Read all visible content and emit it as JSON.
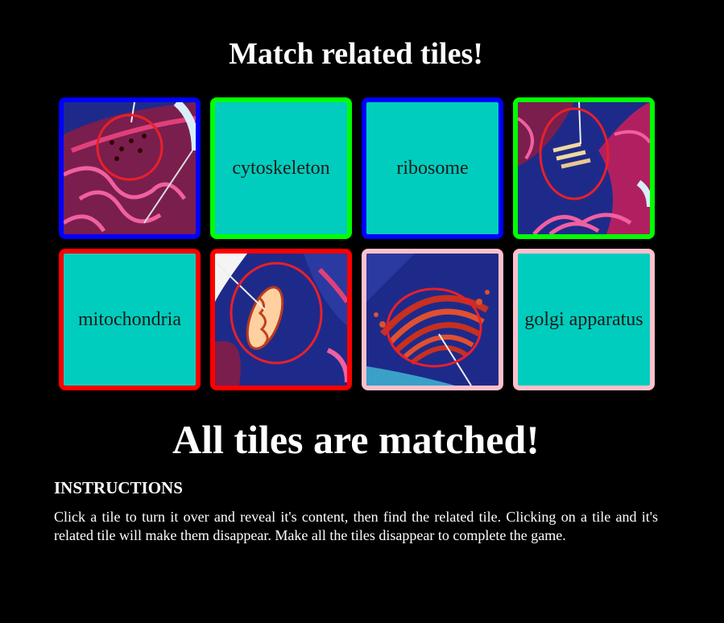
{
  "title": "Match related tiles!",
  "tiles": [
    {
      "type": "image",
      "icon": "ribosome-diagram-icon",
      "border_color": "#0000ff"
    },
    {
      "type": "text",
      "label": "cytoskeleton",
      "border_color": "#00ff00"
    },
    {
      "type": "text",
      "label": "ribosome",
      "border_color": "#0000ff"
    },
    {
      "type": "image",
      "icon": "cytoskeleton-diagram-icon",
      "border_color": "#00ff00"
    },
    {
      "type": "text",
      "label": "mitochondria",
      "border_color": "#ff0000"
    },
    {
      "type": "image",
      "icon": "mitochondria-diagram-icon",
      "border_color": "#ff0000"
    },
    {
      "type": "image",
      "icon": "golgi-apparatus-diagram-icon",
      "border_color": "#ffc0cb"
    },
    {
      "type": "text",
      "label": "golgi apparatus",
      "border_color": "#ffc0cb"
    }
  ],
  "completion_message": "All tiles are matched!",
  "instructions": {
    "heading": "INSTRUCTIONS",
    "text": "Click a tile to turn it over and reveal it's content, then find the related tile. Clicking on a tile and it's related tile will make them disappear. Make all the tiles disappear to complete the game."
  },
  "colors": {
    "background": "#000000",
    "tile_face": "#00cdbd",
    "cell_blue": "#1e2a8a",
    "membrane_pink": "#e0407a",
    "highlight_circle": "#e8202a"
  }
}
